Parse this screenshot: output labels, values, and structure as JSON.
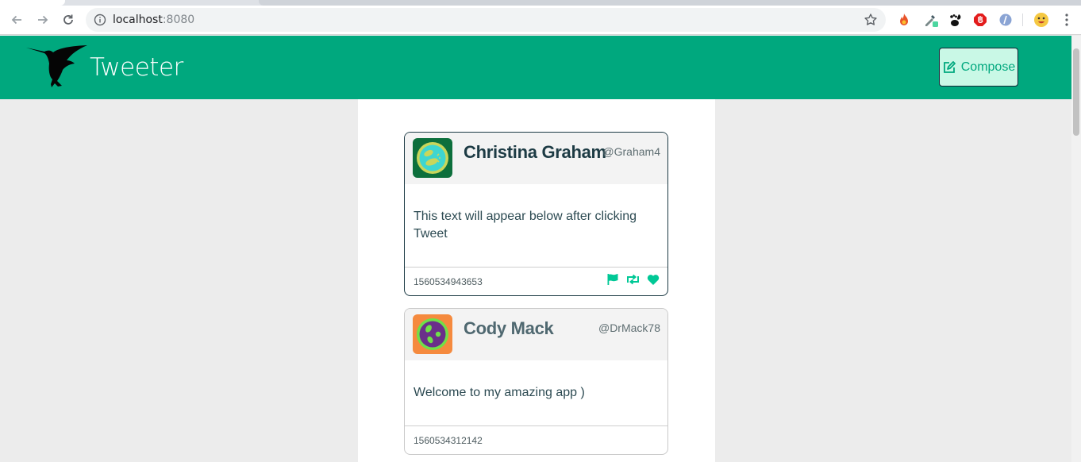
{
  "browser": {
    "url_host": "localhost",
    "url_port": ":8080"
  },
  "app": {
    "title": "Tweeter",
    "compose_label": "Compose",
    "accent_color": "#00a87e"
  },
  "tweets": [
    {
      "name": "Christina Graham",
      "handle": "@Graham4",
      "text": "This text will appear below after clicking Tweet",
      "timestamp": "1560534943653",
      "actions": [
        "flag-icon",
        "retweet-icon",
        "heart-icon"
      ]
    },
    {
      "name": "Cody Mack",
      "handle": "@DrMack78",
      "text": "Welcome to my amazing app )",
      "timestamp": "1560534312142"
    }
  ]
}
